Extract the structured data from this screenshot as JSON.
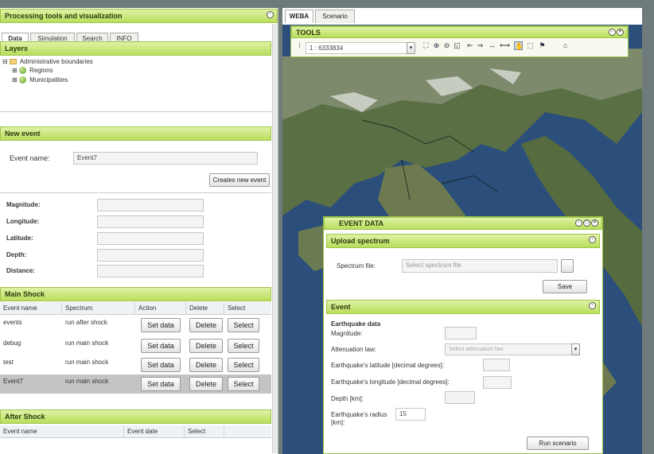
{
  "left_panel": {
    "title": "Processing tools and visualization",
    "tabs": [
      "Data",
      "Simulation",
      "Search",
      "INFO"
    ],
    "layers": {
      "title": "Layers",
      "root": "Administrative boundaries",
      "children": [
        "Regions",
        "Municipalities"
      ]
    },
    "new_event": {
      "title": "New event",
      "event_name_label": "Event name:",
      "event_name_value": "Event7",
      "create_button": "Creates new event",
      "params": [
        "Magnitude:",
        "Longitude:",
        "Latitude:",
        "Depth:",
        "Distance:"
      ]
    },
    "main_shock": {
      "title": "Main Shock",
      "columns": [
        "Event name",
        "Spectrum",
        "Action",
        "Delete",
        "Select"
      ],
      "rows": [
        {
          "name": "events",
          "spectrum": "run after shock",
          "action": "Set data",
          "delete": "Delete",
          "select": "Select"
        },
        {
          "name": "debug",
          "spectrum": "run main shock",
          "action": "Set data",
          "delete": "Delete",
          "select": "Select"
        },
        {
          "name": "test",
          "spectrum": "run main shock",
          "action": "Set data",
          "delete": "Delete",
          "select": "Select"
        },
        {
          "name": "Event7",
          "spectrum": "run main shock",
          "action": "Set data",
          "delete": "Delete",
          "select": "Select"
        }
      ]
    },
    "after_shock": {
      "title": "After Shock",
      "columns": [
        "Event name",
        "Event date",
        "Select"
      ]
    }
  },
  "right_panel": {
    "tabs": [
      "WEBA",
      "Scenario"
    ],
    "tools": {
      "title": "TOOLS",
      "scale_value": "1 : 6333834"
    },
    "event_data": {
      "title": "EVENT DATA",
      "upload": {
        "title": "Upload spectrum",
        "file_label": "Spectrum file:",
        "file_placeholder": "Select spectrum file",
        "save_button": "Save"
      },
      "event": {
        "title": "Event",
        "subtitle": "Earthquake data",
        "magnitude_label": "Magnitude:",
        "attenuation_label": "Attenuation law:",
        "attenuation_placeholder": "Select attenuation law",
        "latitude_label": "Earthquake's latitude [decimal degrees]:",
        "longitude_label": "Earthquake's longitude [decimal degrees]:",
        "depth_label": "Depth [km]:",
        "radius_label": "Earthquake's radius [km]:",
        "radius_value": "15",
        "run_button": "Run scenario"
      }
    }
  },
  "colors": {
    "header_green": "#b9de5c",
    "panel_border": "#9fc44a",
    "sea": "#2b4f7a",
    "land": "#4b6a3a"
  }
}
